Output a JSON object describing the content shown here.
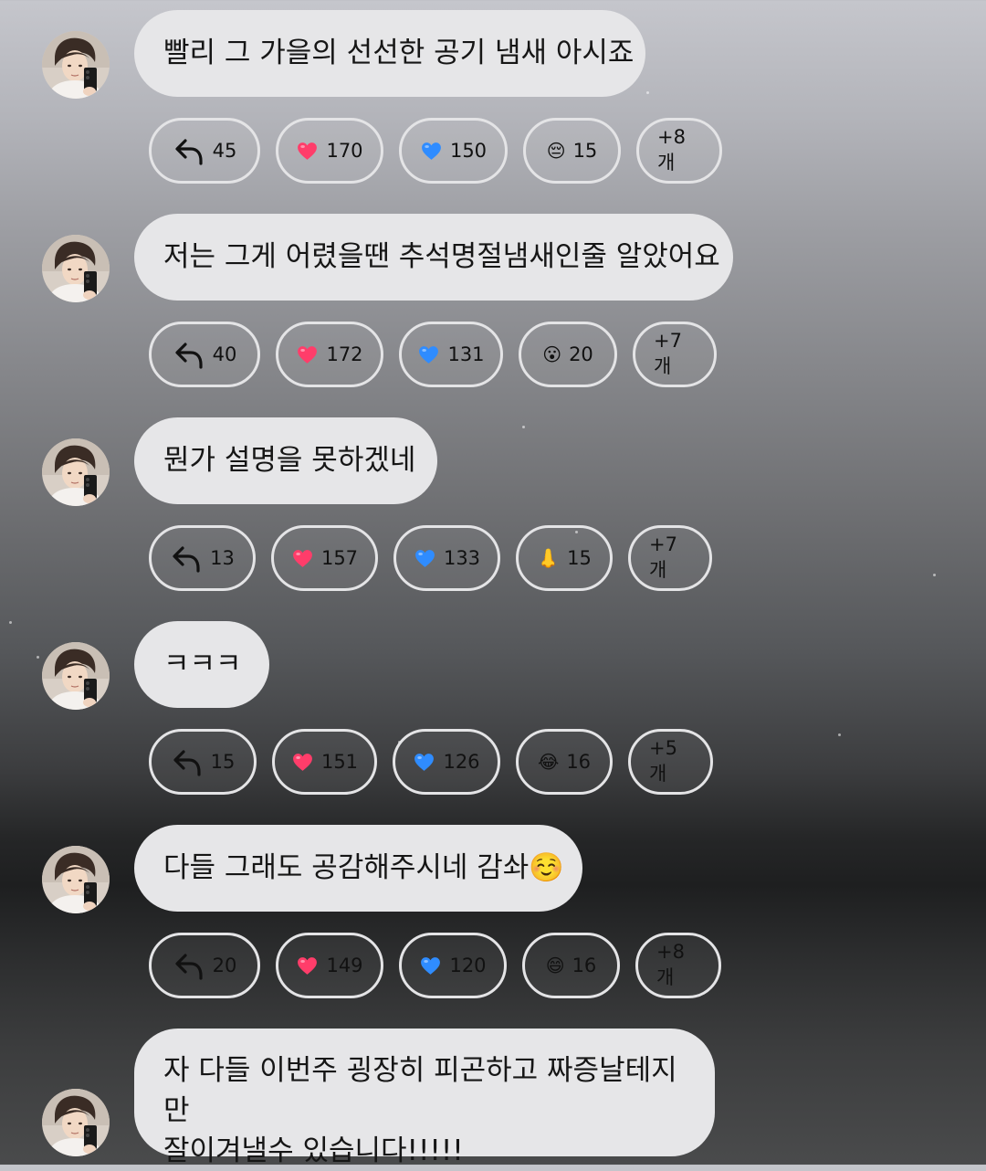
{
  "messages": [
    {
      "text": "빨리 그 가을의 선선한 공기 냄새 아시죠",
      "reactions": {
        "reply": "45",
        "heart": "170",
        "blue_heart": "150",
        "emoji": "😔",
        "emoji_count": "15",
        "more": "+8개"
      }
    },
    {
      "text": "저는 그게 어렸을땐 추석명절냄새인줄 알았어요",
      "reactions": {
        "reply": "40",
        "heart": "172",
        "blue_heart": "131",
        "emoji": "😮",
        "emoji_count": "20",
        "more": "+7개"
      }
    },
    {
      "text": "뭔가 설명을 못하겠네",
      "reactions": {
        "reply": "13",
        "heart": "157",
        "blue_heart": "133",
        "emoji": "👃",
        "emoji_count": "15",
        "more": "+7개"
      }
    },
    {
      "text": "ㅋㅋㅋ",
      "reactions": {
        "reply": "15",
        "heart": "151",
        "blue_heart": "126",
        "emoji": "😂",
        "emoji_count": "16",
        "more": "+5개"
      }
    },
    {
      "text": "다들 그래도 공감해주시네 감솨☺️",
      "reactions": {
        "reply": "20",
        "heart": "149",
        "blue_heart": "120",
        "emoji": "😄",
        "emoji_count": "16",
        "more": "+8개"
      }
    },
    {
      "text_line1": "자 다들 이번주 굉장히 피곤하고 짜증날테지만",
      "text_line2": "잘이겨낼수 있습니다!!!!!"
    }
  ],
  "colors": {
    "bubble": "#e6e6e8",
    "pill_border": "#e4e4e6",
    "heart": "#ff3d6a",
    "blue_heart": "#2f8cff"
  },
  "icons": [
    "reply-arrow-icon",
    "heart-icon",
    "blue-heart-icon"
  ]
}
